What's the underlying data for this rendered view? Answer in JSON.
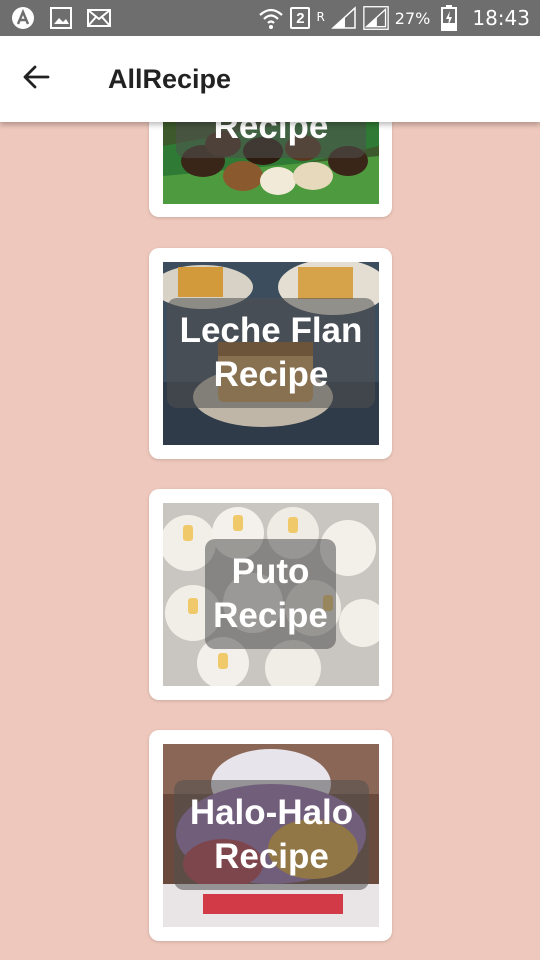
{
  "status_bar": {
    "sim_slot": "2",
    "roaming": "R",
    "battery": "27%",
    "time": "18:43"
  },
  "app_bar": {
    "title": "AllRecipe"
  },
  "recipes": [
    {
      "label": "Recipe"
    },
    {
      "label": "Leche Flan\nRecipe"
    },
    {
      "label": "Puto\nRecipe"
    },
    {
      "label": "Halo-Halo\nRecipe"
    }
  ],
  "colors": {
    "background": "#eec8bc",
    "status_bar": "#6e6e6e",
    "app_bar": "#ffffff"
  }
}
